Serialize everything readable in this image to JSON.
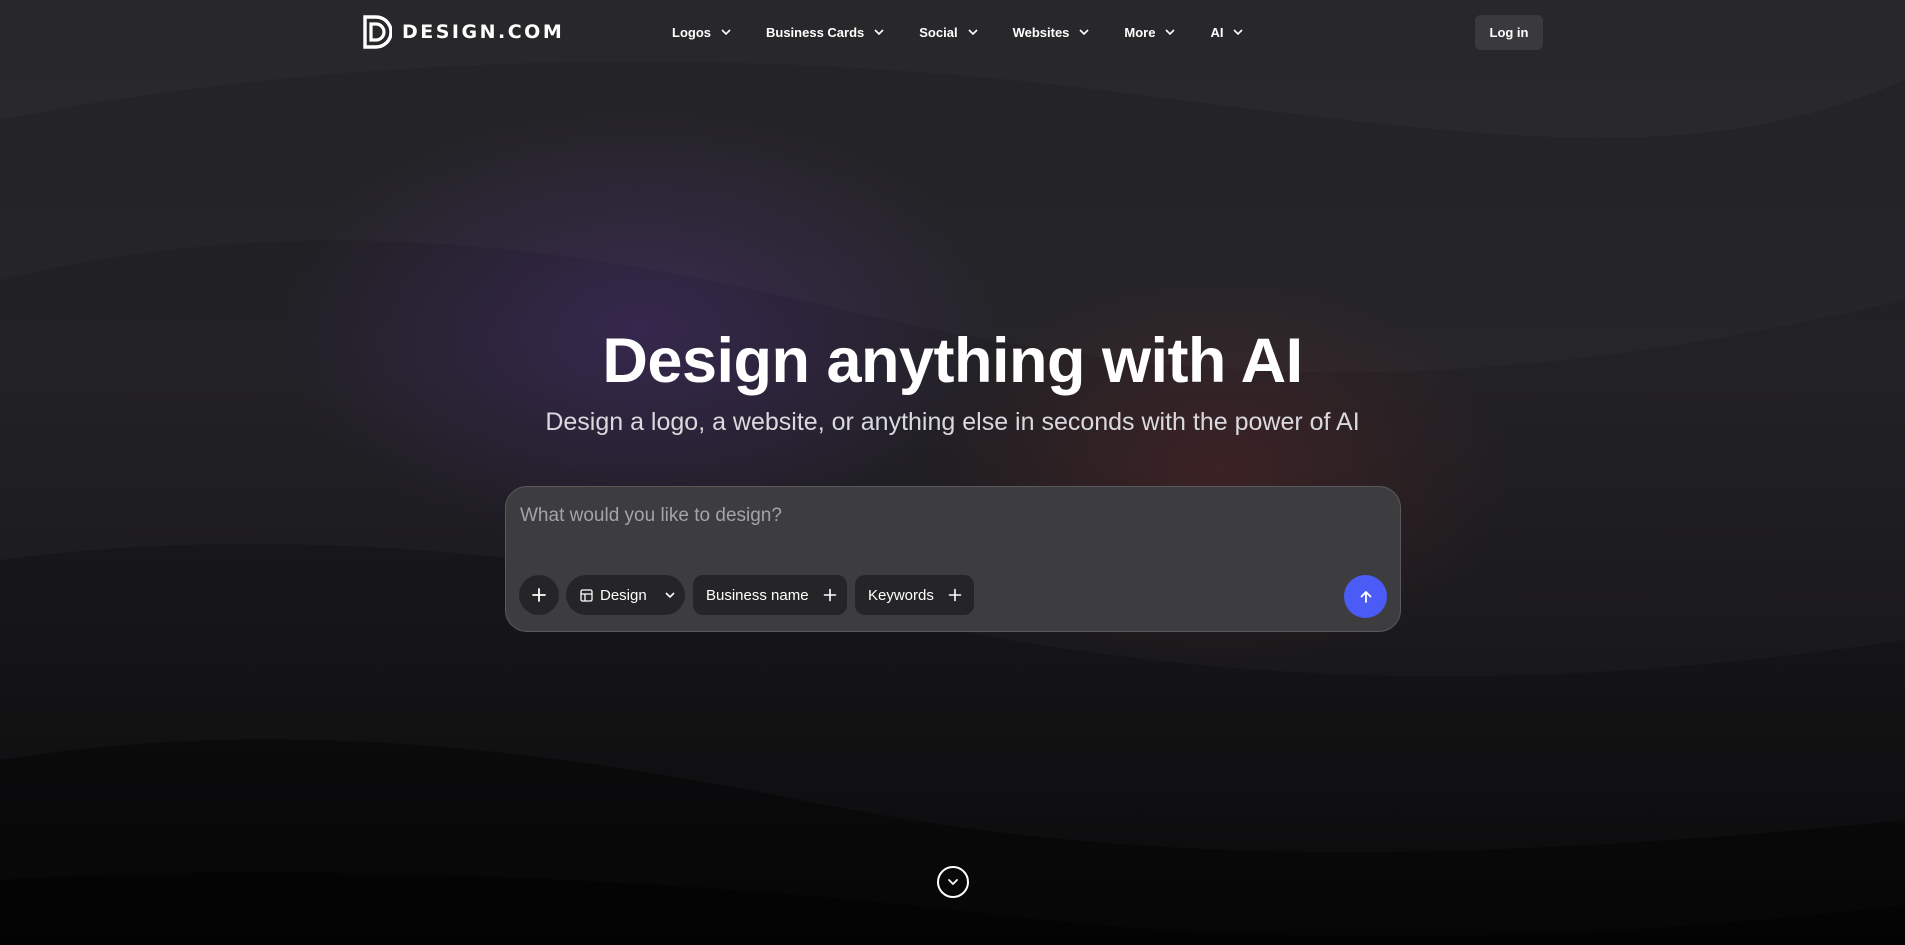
{
  "brand": {
    "name": "DESIGN.COM"
  },
  "nav": {
    "items": [
      {
        "label": "Logos"
      },
      {
        "label": "Business Cards"
      },
      {
        "label": "Social"
      },
      {
        "label": "Websites"
      },
      {
        "label": "More"
      },
      {
        "label": "AI"
      }
    ],
    "login_label": "Log in"
  },
  "hero": {
    "title": "Design anything with AI",
    "subtitle": "Design a logo, a website, or anything else in seconds with the power of AI"
  },
  "prompt": {
    "placeholder": "What would you like to design?",
    "value": "",
    "chips": {
      "design": "Design",
      "business_name": "Business name",
      "keywords": "Keywords"
    }
  },
  "colors": {
    "accent": "#4a5cf5",
    "background": "#1a1a1c",
    "panel": "#3d3d3f"
  },
  "icons": {
    "nav_chevron": "chevron-down-icon",
    "add": "plus-icon",
    "layout": "layout-icon",
    "submit": "arrow-up-icon",
    "scroll": "chevron-down-circle-icon"
  }
}
